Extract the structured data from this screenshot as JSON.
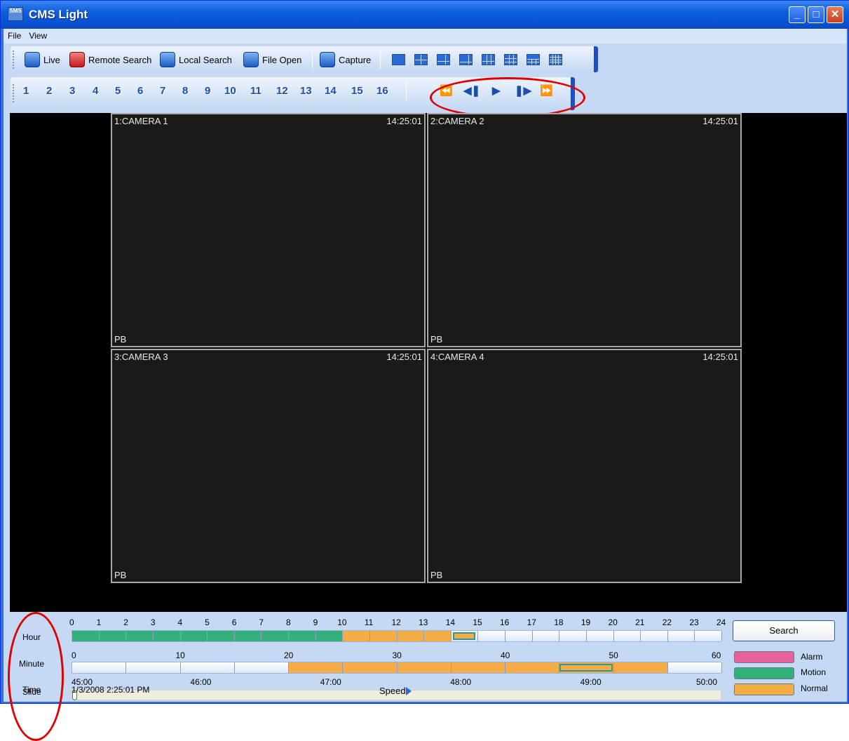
{
  "window": {
    "title": "CMS Light",
    "app_icon_text": "SMS"
  },
  "menu": [
    "File",
    "View"
  ],
  "toolbar": {
    "live": "Live",
    "remote_search": "Remote Search",
    "local_search": "Local Search",
    "file_open": "File Open",
    "capture": "Capture"
  },
  "channels": [
    "1",
    "2",
    "3",
    "4",
    "5",
    "6",
    "7",
    "8",
    "9",
    "10",
    "11",
    "12",
    "13",
    "14",
    "15",
    "16"
  ],
  "playback": [
    "rewind-icon",
    "step-back-icon",
    "play-icon",
    "step-forward-icon",
    "fast-forward-icon"
  ],
  "cameras": [
    {
      "name": "1:CAMERA 1",
      "time": "14:25:01",
      "mode": "PB"
    },
    {
      "name": "2:CAMERA 2",
      "time": "14:25:01",
      "mode": "PB"
    },
    {
      "name": "3:CAMERA 3",
      "time": "14:25:01",
      "mode": "PB"
    },
    {
      "name": "4:CAMERA 4",
      "time": "14:25:01",
      "mode": "PB"
    }
  ],
  "labels": {
    "hour": "Hour",
    "minute": "Minute",
    "slide": "Slide",
    "time": "Time"
  },
  "hour_ticks": [
    "0",
    "1",
    "2",
    "3",
    "4",
    "5",
    "6",
    "7",
    "8",
    "9",
    "10",
    "11",
    "12",
    "13",
    "14",
    "15",
    "16",
    "17",
    "18",
    "19",
    "20",
    "21",
    "22",
    "23",
    "24"
  ],
  "minute_ticks": [
    "0",
    "10",
    "20",
    "30",
    "40",
    "50",
    "60"
  ],
  "slide_ticks": [
    "45:00",
    "46:00",
    "47:00",
    "48:00",
    "49:00",
    "50:00"
  ],
  "time_value": "1/3/2008 2:25:01 PM",
  "speed_label": "Speed",
  "search_button": "Search",
  "legend": [
    {
      "label": "Alarm",
      "color": "#e8609a"
    },
    {
      "label": "Motion",
      "color": "#33b07a"
    },
    {
      "label": "Normal",
      "color": "#f4ad46"
    }
  ]
}
